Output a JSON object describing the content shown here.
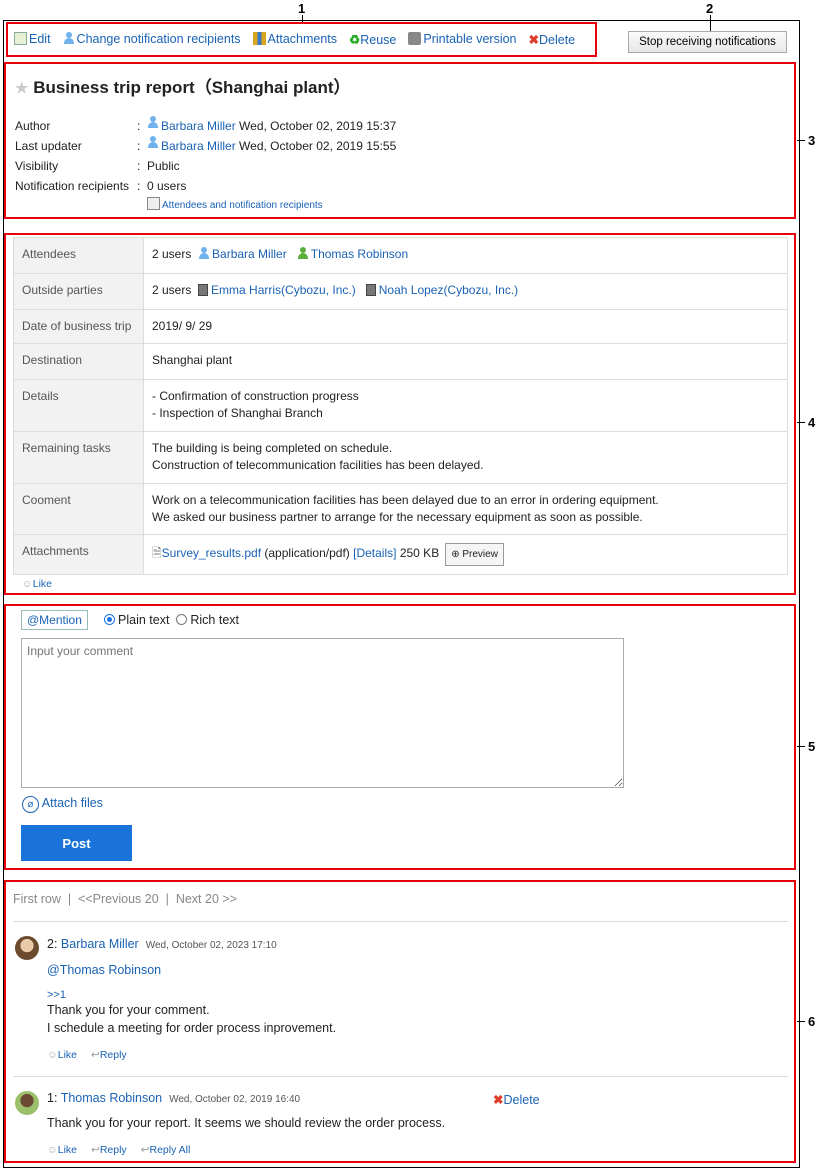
{
  "callouts": [
    "1",
    "2",
    "3",
    "4",
    "5",
    "6"
  ],
  "toolbar": {
    "edit": "Edit",
    "change_recipients": "Change notification recipients",
    "attachments": "Attachments",
    "reuse": "Reuse",
    "printable": "Printable version",
    "delete": "Delete"
  },
  "stop_button": "Stop receiving notifications",
  "header": {
    "title": "Business trip report（Shanghai plant）",
    "meta": [
      {
        "label": "Author",
        "user": "Barbara Miller",
        "value": "Wed, October 02, 2019 15:37"
      },
      {
        "label": "Last updater",
        "user": "Barbara Miller",
        "value": "Wed, October 02, 2019 15:55"
      },
      {
        "label": "Visibility",
        "value": "Public"
      },
      {
        "label": "Notification recipients",
        "value": "0 users"
      }
    ],
    "attendees_link": "Attendees and notification recipients"
  },
  "details": {
    "attendees": {
      "label": "Attendees",
      "count": "2 users",
      "users": [
        "Barbara Miller",
        "Thomas Robinson"
      ]
    },
    "outside": {
      "label": "Outside parties",
      "count": "2 users",
      "users": [
        "Emma Harris(Cybozu, Inc.)",
        "Noah Lopez(Cybozu, Inc.)"
      ]
    },
    "date": {
      "label": "Date of business trip",
      "value": "2019/ 9/ 29"
    },
    "destination": {
      "label": "Destination",
      "value": "Shanghai plant"
    },
    "details": {
      "label": "Details",
      "lines": [
        "- Confirmation of construction progress",
        "- Inspection of Shanghai Branch"
      ]
    },
    "remaining": {
      "label": "Remaining tasks",
      "lines": [
        "The building is being completed on schedule.",
        "Construction of telecommunication facilities has been delayed."
      ]
    },
    "comment": {
      "label": "Cooment",
      "lines": [
        "Work on a telecommunication facilities has been delayed due to an error in ordering equipment.",
        "We asked our business partner to arrange for the necessary equipment as soon as possible."
      ]
    },
    "attachments": {
      "label": "Attachments",
      "file": "Survey_results.pdf",
      "type": "(application/pdf)",
      "details": "[Details]",
      "size": "250 KB",
      "preview": "Preview"
    },
    "like": "Like"
  },
  "composer": {
    "mention": "@Mention",
    "plain": "Plain text",
    "rich": "Rich text",
    "placeholder": "Input your comment",
    "attach": "Attach files",
    "post": "Post"
  },
  "pager": {
    "first": "First row",
    "prev": "<<Previous 20",
    "next": "Next 20 >>"
  },
  "comments": [
    {
      "num": "2:",
      "user": "Barbara Miller",
      "time": "Wed, October 02, 2023 17:10",
      "mention": "@Thomas Robinson",
      "ref": ">>1",
      "lines": [
        "Thank you for your comment.",
        "I schedule a meeting for order process inprovement."
      ],
      "like": "Like",
      "reply": "Reply"
    },
    {
      "num": "1:",
      "user": "Thomas Robinson",
      "time": "Wed, October 02, 2019 16:40",
      "delete": "Delete",
      "lines": [
        "Thank you for your report. It seems we should review the order process."
      ],
      "like": "Like",
      "reply": "Reply",
      "reply_all": "Reply All"
    }
  ]
}
